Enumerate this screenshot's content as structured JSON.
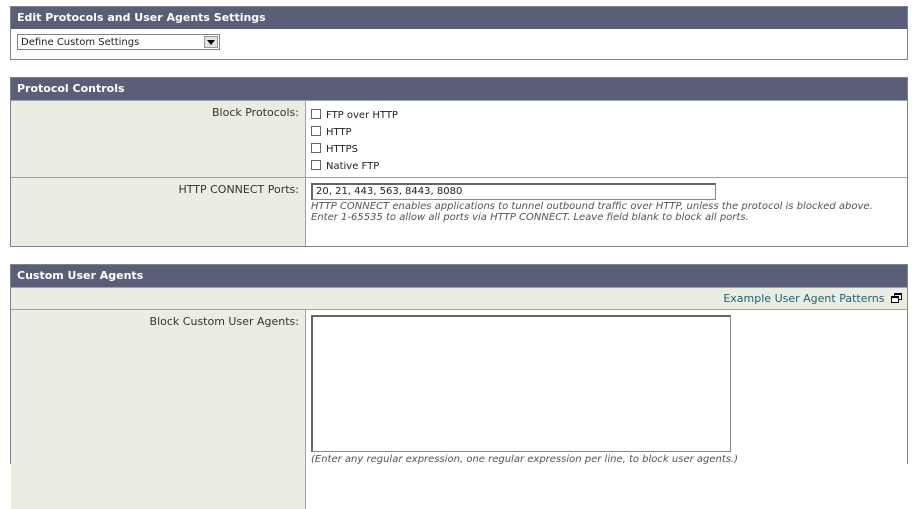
{
  "edit_panel": {
    "title": "Edit Protocols and User Agents Settings",
    "select_value": "Define Custom Settings"
  },
  "protocol_panel": {
    "title": "Protocol Controls",
    "block_label": "Block Protocols:",
    "protocols": [
      {
        "label": "FTP over HTTP",
        "checked": false
      },
      {
        "label": "HTTP",
        "checked": false
      },
      {
        "label": "HTTPS",
        "checked": false
      },
      {
        "label": "Native FTP",
        "checked": false
      }
    ],
    "connect_label": "HTTP CONNECT Ports:",
    "connect_value": "20, 21, 443, 563, 8443, 8080",
    "connect_help": "HTTP CONNECT enables applications to tunnel outbound traffic over HTTP, unless the protocol is blocked above. Enter 1-65535 to allow all ports via HTTP CONNECT. Leave field blank to block all ports."
  },
  "agents_panel": {
    "title": "Custom User Agents",
    "example_link": "Example User Agent Patterns",
    "block_label": "Block Custom User Agents:",
    "textarea_value": "",
    "help": "(Enter any regular expression, one regular expression per line, to block user agents.)"
  },
  "icons": {
    "dropdown": "chevron-down-icon",
    "popup": "new-window-icon"
  }
}
